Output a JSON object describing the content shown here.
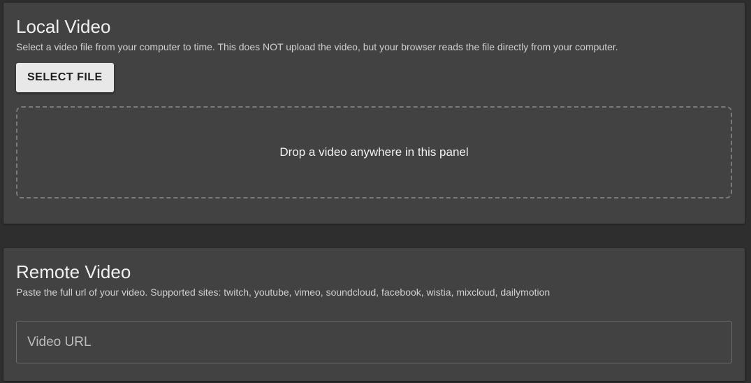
{
  "local": {
    "title": "Local Video",
    "description": "Select a video file from your computer to time. This does NOT upload the video, but your browser reads the file directly from your computer.",
    "select_button": "SELECT FILE",
    "drop_text": "Drop a video anywhere in this panel"
  },
  "remote": {
    "title": "Remote Video",
    "description": "Paste the full url of your video. Supported sites: twitch, youtube, vimeo, soundcloud, facebook, wistia, mixcloud, dailymotion",
    "url_placeholder": "Video URL",
    "url_value": ""
  },
  "colors": {
    "background": "#2e2e2e",
    "panel": "#424242",
    "button": "#e8e8e8"
  }
}
